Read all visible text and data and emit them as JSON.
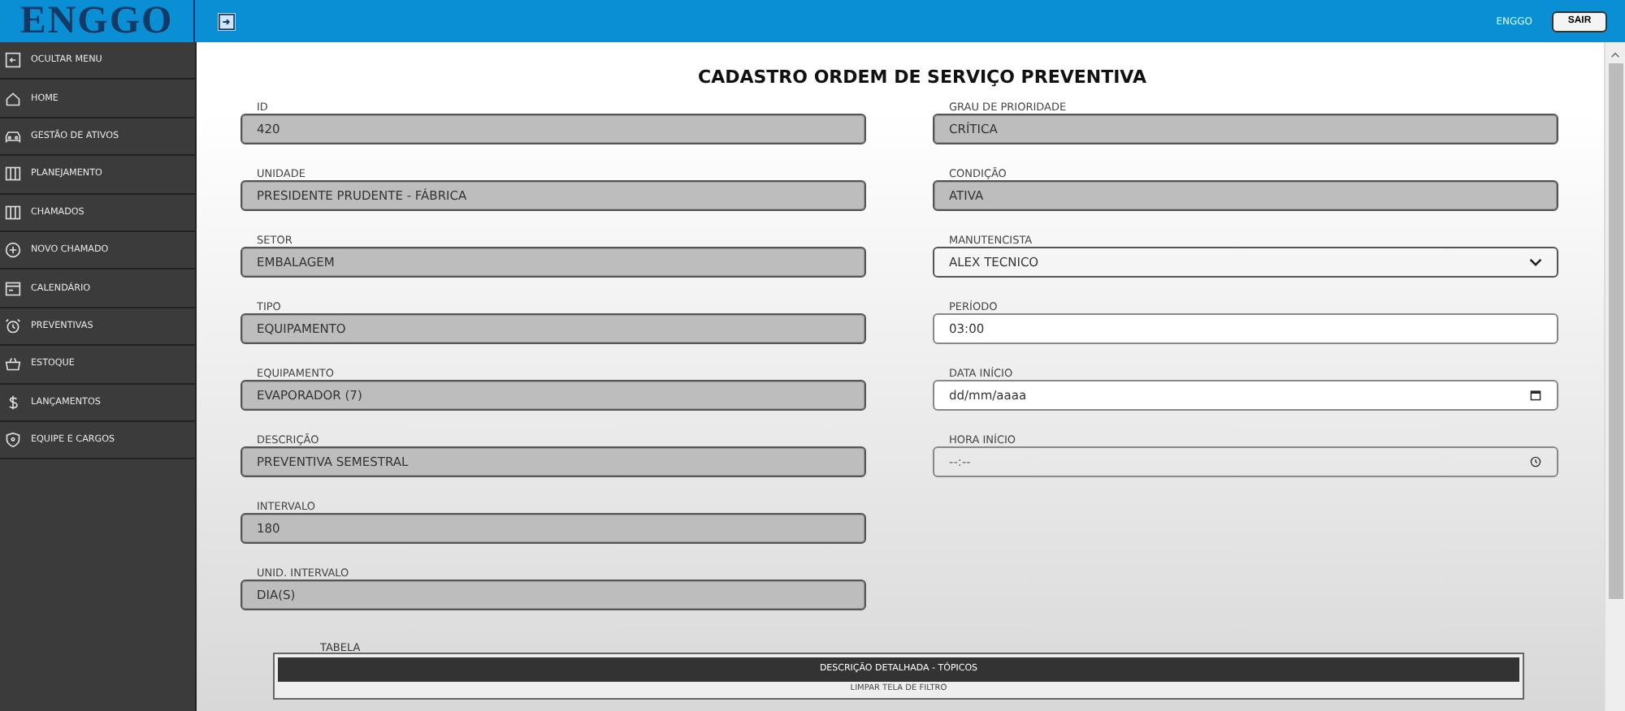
{
  "logo": "ENGGO",
  "topbar": {
    "user": "ENGGO",
    "logout_button": "SAIR"
  },
  "sidebar": {
    "items": [
      {
        "label": "OCULTAR MENU"
      },
      {
        "label": "HOME"
      },
      {
        "label": "GESTÃO DE ATIVOS"
      },
      {
        "label": "PLANEJAMENTO"
      },
      {
        "label": "CHAMADOS"
      },
      {
        "label": "NOVO CHAMADO"
      },
      {
        "label": "CALENDÁRIO"
      },
      {
        "label": "PREVENTIVAS"
      },
      {
        "label": "ESTOQUE"
      },
      {
        "label": "LANÇAMENTOS"
      },
      {
        "label": "EQUIPE E CARGOS"
      }
    ]
  },
  "form": {
    "title": "CADASTRO ORDEM DE SERVIÇO PREVENTIVA",
    "left_fields": [
      {
        "label": "ID",
        "value": "420",
        "kind": "readonly"
      },
      {
        "label": "UNIDADE",
        "value": "PRESIDENTE PRUDENTE - FÁBRICA",
        "kind": "readonly"
      },
      {
        "label": "SETOR",
        "value": "EMBALAGEM",
        "kind": "readonly"
      },
      {
        "label": "TIPO",
        "value": "EQUIPAMENTO",
        "kind": "readonly"
      },
      {
        "label": "EQUIPAMENTO",
        "value": "EVAPORADOR (7)",
        "kind": "readonly"
      },
      {
        "label": "DESCRIÇÃO",
        "value": "PREVENTIVA SEMESTRAL",
        "kind": "readonly"
      },
      {
        "label": "INTERVALO",
        "value": "180",
        "kind": "readonly"
      },
      {
        "label": "UNID. INTERVALO",
        "value": "DIA(S)",
        "kind": "readonly"
      }
    ],
    "right_fields": [
      {
        "label": "GRAU DE PRIORIDADE",
        "value": "CRÍTICA",
        "kind": "readonly"
      },
      {
        "label": "CONDIÇÃO",
        "value": "ATIVA",
        "kind": "readonly"
      },
      {
        "label": "MANUTENCISTA",
        "value": "ALEX TECNICO",
        "kind": "select"
      },
      {
        "label": "PERÍODO",
        "value": "03:00",
        "kind": "text"
      },
      {
        "label": "DATA INÍCIO",
        "placeholder": "dd/mm/aaaa",
        "kind": "date"
      },
      {
        "label": "HORA INÍCIO",
        "placeholder": "--:--",
        "kind": "time"
      }
    ],
    "table": {
      "label": "TABELA",
      "header": "DESCRIÇÃO DETALHADA - TÓPICOS",
      "rows": [
        "LIMPAR TELA DE FILTRO"
      ]
    }
  }
}
